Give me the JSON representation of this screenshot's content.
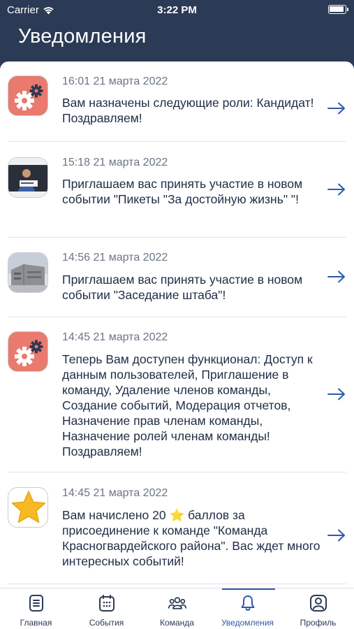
{
  "status_bar": {
    "carrier": "Carrier",
    "time": "3:22 PM"
  },
  "header": {
    "title": "Уведомления"
  },
  "notifications": [
    {
      "time": "16:01 21 марта 2022",
      "message": "Вам назначены следующие роли: Кандидат! Поздравляем!",
      "icon": "gear-icon"
    },
    {
      "time": "15:18 21 марта 2022",
      "message": "Приглашаем вас принять участие в новом событии \"Пикеты \"За достойную жизнь\" \"!",
      "icon": "person-photo"
    },
    {
      "time": "14:56 21 марта 2022",
      "message": "Приглашаем вас принять участие в новом событии \"Заседание штаба\"!",
      "icon": "building-photo"
    },
    {
      "time": "14:45 21 марта 2022",
      "message": "Теперь Вам доступен функционал: Доступ к данным пользователей, Приглашение в команду, Удаление членов команды, Создание событий, Модерация отчетов, Назначение прав членам команды, Назначение ролей членам команды! Поздравляем!",
      "icon": "gear-icon"
    },
    {
      "time": "14:45 21 марта 2022",
      "message": "Вам начислено 20 ⭐ баллов за присоединение к команде \"Команда Красногвардейского района\". Вас ждет много интересных событий!",
      "icon": "star-icon"
    }
  ],
  "tabs": [
    {
      "label": "Главная",
      "icon": "document-icon",
      "active": false
    },
    {
      "label": "События",
      "icon": "calendar-icon",
      "active": false
    },
    {
      "label": "Команда",
      "icon": "team-icon",
      "active": false
    },
    {
      "label": "Уведомления",
      "icon": "bell-icon",
      "active": true
    },
    {
      "label": "Профиль",
      "icon": "profile-icon",
      "active": false
    }
  ],
  "colors": {
    "header_bg": "#2b3a55",
    "accent": "#2f5aa8",
    "gear_bg": "#e97a6d"
  }
}
